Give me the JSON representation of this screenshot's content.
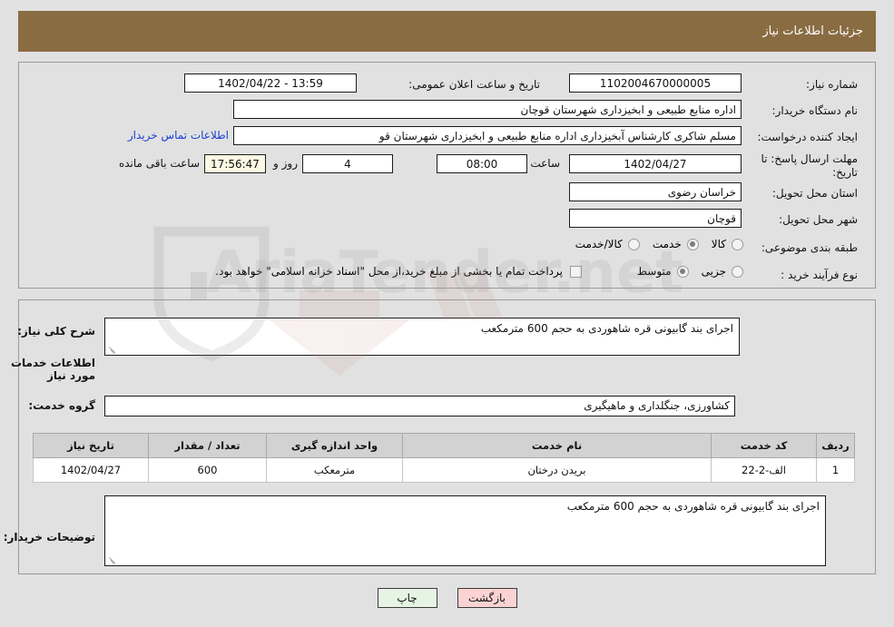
{
  "header": {
    "title": "جزئیات اطلاعات نیاز"
  },
  "form": {
    "need_number_label": "شماره نیاز:",
    "need_number_value": "1102004670000005",
    "announce_label": "تاریخ و ساعت اعلان عمومی:",
    "announce_value": "13:59 - 1402/04/22",
    "buyer_org_label": "نام دستگاه خریدار:",
    "buyer_org_value": "اداره منابع طبیعی و ابخیزداری شهرستان قوچان",
    "requester_label": "ایجاد کننده درخواست:",
    "requester_value": "مسلم شاکری کارشناس آبخیزداری اداره منابع طبیعی و ابخیزداری شهرستان قو",
    "contact_link": "اطلاعات تماس خریدار",
    "deadline_label": "مهلت ارسال پاسخ: تا تاریخ:",
    "deadline_date": "1402/04/27",
    "hour_label": "ساعت",
    "hour_value": "08:00",
    "days_value": "4",
    "days_label": "روز و",
    "countdown_value": "17:56:47",
    "countdown_label": "ساعت باقی مانده",
    "province_label": "استان محل تحویل:",
    "province_value": "خراسان رضوی",
    "city_label": "شهر محل تحویل:",
    "city_value": "قوچان",
    "category_label": "طبقه بندی موضوعی:",
    "category_options": [
      {
        "label": "کالا",
        "selected": false
      },
      {
        "label": "خدمت",
        "selected": true
      },
      {
        "label": "کالا/خدمت",
        "selected": false
      }
    ],
    "process_label": "نوع فرآیند خرید :",
    "process_options": [
      {
        "label": "جزیی",
        "selected": false
      },
      {
        "label": "متوسط",
        "selected": true
      }
    ],
    "treasury_checkbox_label": "پرداخت تمام یا بخشی از مبلغ خرید،از محل \"اسناد خزانه اسلامی\" خواهد بود.",
    "treasury_checked": false
  },
  "description": {
    "general_label": "شرح کلی نیاز:",
    "general_value": "اجرای بند گابیونی قره شاهوردی به حجم 600 مترمکعب",
    "services_heading": "اطلاعات خدمات مورد نیاز",
    "service_group_label": "گروه خدمت:",
    "service_group_value": "کشاورزی، جنگلداری و ماهیگیری"
  },
  "table": {
    "headers": [
      "ردیف",
      "کد خدمت",
      "نام خدمت",
      "واحد اندازه گیری",
      "تعداد / مقدار",
      "تاریخ نیاز"
    ],
    "rows": [
      [
        "1",
        "الف-2-22",
        "بریدن درختان",
        "مترمعکب",
        "600",
        "1402/04/27"
      ]
    ]
  },
  "buyer_notes": {
    "label": "توضیحات خریدار:",
    "value": "اجرای بند گابیونی قره شاهوردی به حجم 600 مترمکعب"
  },
  "buttons": {
    "print": "چاپ",
    "back": "بازگشت"
  },
  "watermark": {
    "text": "AriaTender.net"
  }
}
